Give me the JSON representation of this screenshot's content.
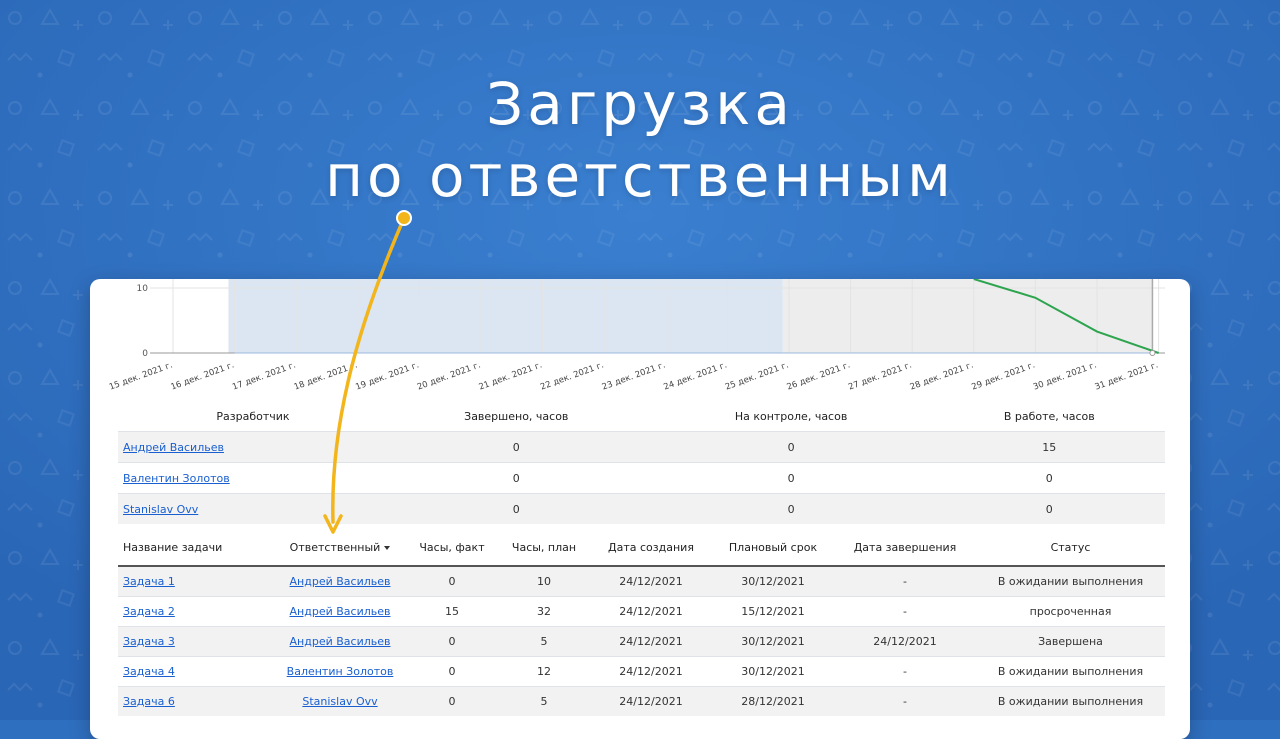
{
  "headline": {
    "line1": "Загрузка",
    "line2": "по ответственным"
  },
  "colors": {
    "background": "#2f6fbf",
    "accent_arrow": "#f2b51c",
    "trend_line": "#2ea44f",
    "link": "#1a5fd0"
  },
  "chart_data": {
    "type": "area",
    "y_ticks": [
      "0",
      "10"
    ],
    "categories": [
      "15 дек. 2021 г.",
      "16 дек. 2021 г.",
      "17 дек. 2021 г.",
      "18 дек. 2021 г.",
      "19 дек. 2021 г.",
      "20 дек. 2021 г.",
      "21 дек. 2021 г.",
      "22 дек. 2021 г.",
      "23 дек. 2021 г.",
      "24 дек. 2021 г.",
      "25 дек. 2021 г.",
      "26 дек. 2021 г.",
      "27 дек. 2021 г.",
      "28 дек. 2021 г.",
      "29 дек. 2021 г.",
      "30 дек. 2021 г.",
      "31 дек. 2021 г."
    ],
    "ylim": [
      0,
      13
    ],
    "series": [
      {
        "values": [
          null,
          0,
          0,
          0,
          0,
          0,
          0,
          0,
          0,
          0,
          0,
          0,
          0,
          0,
          0,
          0,
          0
        ]
      },
      {
        "values": [
          null,
          null,
          null,
          null,
          null,
          null,
          null,
          null,
          null,
          null,
          null,
          null,
          null,
          13,
          8.5,
          3.3,
          0
        ]
      }
    ]
  },
  "developers": {
    "headers": [
      "Разработчик",
      "Завершено, часов",
      "На контроле, часов",
      "В работе, часов"
    ],
    "rows": [
      {
        "name": "Андрей Васильев",
        "done": "0",
        "control": "0",
        "work": "15"
      },
      {
        "name": "Валентин Золотов",
        "done": "0",
        "control": "0",
        "work": "0"
      },
      {
        "name": "Stanislav Ovv",
        "done": "0",
        "control": "0",
        "work": "0"
      }
    ]
  },
  "tasks": {
    "headers": [
      "Название задачи",
      "Ответственный",
      "Часы, факт",
      "Часы, план",
      "Дата создания",
      "Плановый срок",
      "Дата завершения",
      "Статус"
    ],
    "rows": [
      {
        "name": "Задача 1",
        "owner": "Андрей Васильев",
        "fact": "0",
        "plan": "10",
        "created": "24/12/2021",
        "due": "30/12/2021",
        "finished": "-",
        "status": "В ожидании выполнения"
      },
      {
        "name": "Задача 2",
        "owner": "Андрей Васильев",
        "fact": "15",
        "plan": "32",
        "created": "24/12/2021",
        "due": "15/12/2021",
        "finished": "-",
        "status": "просроченная"
      },
      {
        "name": "Задача 3",
        "owner": "Андрей Васильев",
        "fact": "0",
        "plan": "5",
        "created": "24/12/2021",
        "due": "30/12/2021",
        "finished": "24/12/2021",
        "status": "Завершена"
      },
      {
        "name": "Задача 4",
        "owner": "Валентин Золотов",
        "fact": "0",
        "plan": "12",
        "created": "24/12/2021",
        "due": "30/12/2021",
        "finished": "-",
        "status": "В ожидании выполнения"
      },
      {
        "name": "Задача 6",
        "owner": "Stanislav Ovv",
        "fact": "0",
        "plan": "5",
        "created": "24/12/2021",
        "due": "28/12/2021",
        "finished": "-",
        "status": "В ожидании выполнения"
      }
    ]
  }
}
